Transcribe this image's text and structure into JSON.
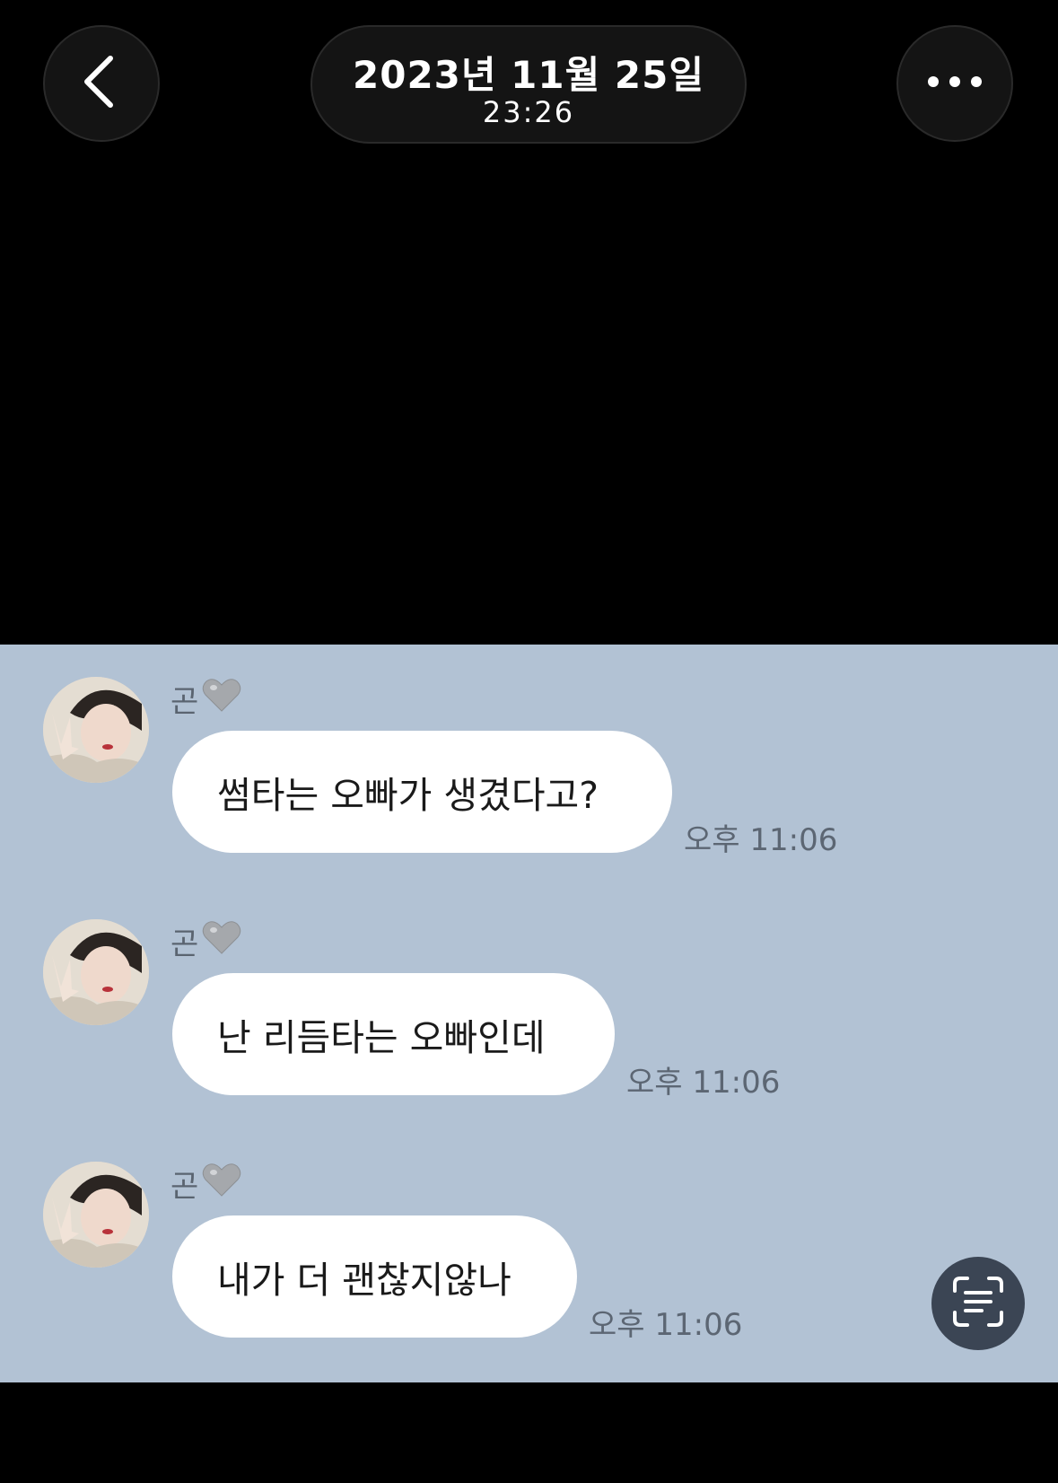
{
  "header": {
    "date": "2023년 11월 25일",
    "time": "23:26",
    "back_icon": "chevron-left-icon",
    "more_icon": "more-horizontal-icon"
  },
  "chat": {
    "background_color": "#b2c2d4",
    "messages": [
      {
        "sender": "곤",
        "sender_emoji": "🩶",
        "text": "썸타는 오빠가 생겼다고?",
        "timestamp": "오후 11:06"
      },
      {
        "sender": "곤",
        "sender_emoji": "🩶",
        "text": "난 리듬타는 오빠인데",
        "timestamp": "오후 11:06"
      },
      {
        "sender": "곤",
        "sender_emoji": "🩶",
        "text": "내가 더 괜찮지않나",
        "timestamp": "오후 11:06"
      }
    ]
  },
  "overlay": {
    "scan_icon": "live-text-scan-icon"
  }
}
